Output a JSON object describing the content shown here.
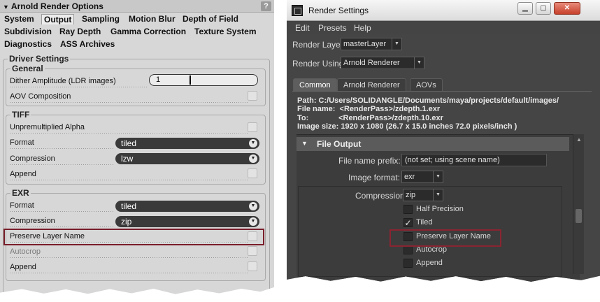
{
  "left": {
    "title": "Arnold Render Options",
    "help_label": "?",
    "tabs_row1": [
      "System",
      "Output",
      "Sampling",
      "Motion Blur",
      "Depth of Field"
    ],
    "tabs_row2": [
      "Subdivision",
      "Ray Depth",
      "Gamma Correction",
      "Texture System"
    ],
    "tabs_row3": [
      "Diagnostics",
      "ASS Archives"
    ],
    "active_tab": "Output",
    "driver_settings": "Driver Settings",
    "general": {
      "title": "General",
      "dither_label": "Dither Amplitude (LDR images)",
      "dither_value": "1",
      "aov_label": "AOV Composition"
    },
    "tiff": {
      "title": "TIFF",
      "unpremult_label": "Unpremultiplied Alpha",
      "format_label": "Format",
      "format_value": "tiled",
      "compression_label": "Compression",
      "compression_value": "lzw",
      "append_label": "Append"
    },
    "exr": {
      "title": "EXR",
      "format_label": "Format",
      "format_value": "tiled",
      "compression_label": "Compression",
      "compression_value": "zip",
      "preserve_label": "Preserve Layer Name",
      "autocrop_label": "Autocrop",
      "append_label": "Append"
    }
  },
  "right": {
    "title": "Render Settings",
    "menu": [
      "Edit",
      "Presets",
      "Help"
    ],
    "render_layer_label": "Render Layer",
    "render_layer_value": "masterLayer",
    "render_using_label": "Render Using",
    "render_using_value": "Arnold Renderer",
    "tabs": [
      "Common",
      "Arnold Renderer",
      "AOVs"
    ],
    "info": {
      "path": "Path: C:/Users/SOLIDANGLE/Documents/maya/projects/default/images/",
      "file_name": "File name:  <RenderPass>/zdepth.1.exr",
      "to": "To:              <RenderPass>/zdepth.10.exr",
      "image_size": "Image size: 1920 x 1080 (26.7 x 15.0 inches 72.0 pixels/inch )"
    },
    "section_title": "File Output",
    "prefix_label": "File name prefix:",
    "prefix_value": "(not set; using scene name)",
    "image_format_label": "Image format:",
    "image_format_value": "exr",
    "compression_label": "Compression",
    "compression_value": "zip",
    "half_precision_label": "Half Precision",
    "tiled_label": "Tiled",
    "preserve_label": "Preserve Layer Name",
    "autocrop_label": "Autocrop",
    "append_label": "Append"
  },
  "colors": {
    "highlight": "#7a1e2a",
    "left_bg": "#d7d7d7",
    "right_bg": "#454545"
  }
}
